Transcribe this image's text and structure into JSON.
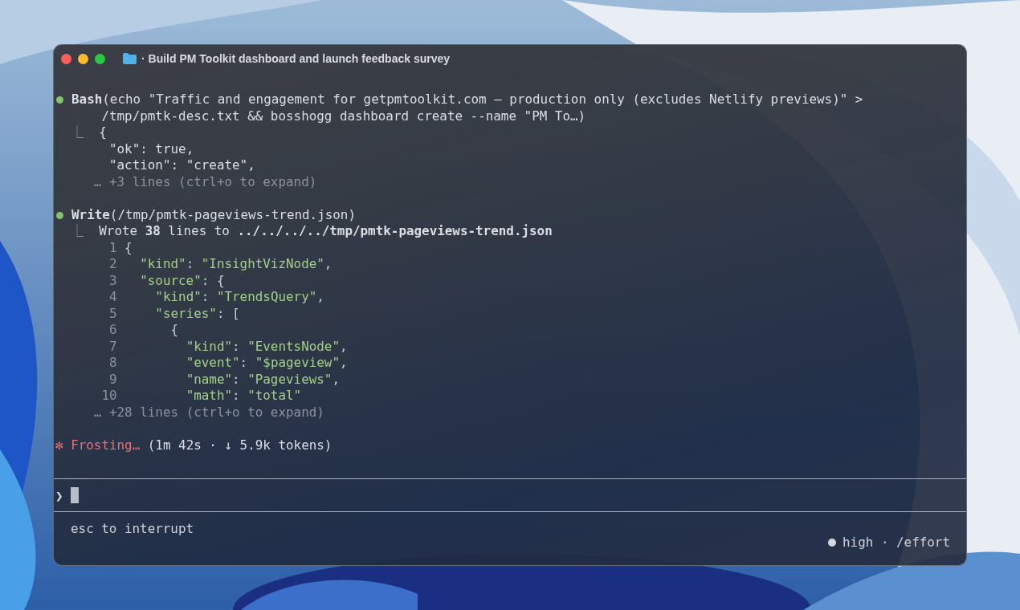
{
  "window": {
    "title": "· Build PM Toolkit dashboard and launch feedback survey"
  },
  "transcript": [
    {
      "kind": "tool",
      "color": "#86c16e",
      "name": "Bash",
      "lines": [
        "(echo \"Traffic and engagement for getpmtoolkit.com — production only (excludes Netlify previews)\" >",
        "/tmp/pmtk-desc.txt && bosshogg dashboard create --name \"PM To…)"
      ],
      "result_mark": "⎿",
      "output": [
        {
          "kind": "text",
          "text": "{"
        },
        {
          "kind": "text",
          "text": "  \"ok\": true,"
        },
        {
          "kind": "text",
          "text": "  \"action\": \"create\","
        },
        {
          "kind": "collapsed",
          "text": "… +3 lines (ctrl+o to expand)"
        }
      ]
    },
    {
      "kind": "tool",
      "color": "#86c16e",
      "name": "Write",
      "lines": [
        "(/tmp/pmtk-pageviews-trend.json)"
      ],
      "result_mark": "⎿",
      "output": [
        {
          "kind": "text",
          "text": "Wrote **38** lines to **../../../../tmp/pmtk-pageviews-trend.json**"
        },
        {
          "kind": "code",
          "number": "1",
          "text": "{"
        },
        {
          "kind": "code",
          "number": "2",
          "text": "  \"kind\": \"InsightVizNode\","
        },
        {
          "kind": "code",
          "number": "3",
          "text": "  \"source\": {"
        },
        {
          "kind": "code",
          "number": "4",
          "text": "    \"kind\": \"TrendsQuery\","
        },
        {
          "kind": "code",
          "number": "5",
          "text": "    \"series\": ["
        },
        {
          "kind": "code",
          "number": "6",
          "text": "      {"
        },
        {
          "kind": "code",
          "number": "7",
          "text": "        \"kind\": \"EventsNode\","
        },
        {
          "kind": "code",
          "number": "8",
          "text": "        \"event\": \"$pageview\","
        },
        {
          "kind": "code",
          "number": "9",
          "text": "        \"name\": \"Pageviews\","
        },
        {
          "kind": "code",
          "number": "10",
          "text": "        \"math\": \"total\""
        },
        {
          "kind": "collapsed",
          "text": "… +28 lines (ctrl+o to expand)"
        }
      ]
    },
    {
      "kind": "status",
      "icon": "✻",
      "verb": "Frosting…",
      "detail": "(1m 42s · ↓ 5.9k tokens)"
    }
  ],
  "prompt": {
    "symbol": "❯"
  },
  "footer": {
    "hint": "esc to interrupt",
    "effort": "high · /effort"
  }
}
